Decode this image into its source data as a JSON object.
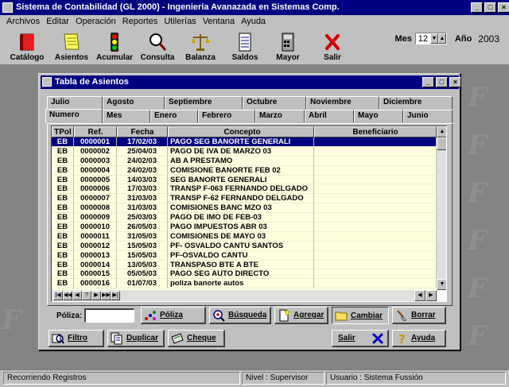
{
  "app": {
    "title": "Sistema de Contabilidad (GL 2000) - Ingeniería Avanazada en Sistemas Comp.",
    "controls": {
      "minimize": "_",
      "restore": "□",
      "close": "×"
    }
  },
  "menu": [
    "Archivos",
    "Editar",
    "Operación",
    "Reportes",
    "Utilerías",
    "Ventana",
    "Ayuda"
  ],
  "toolbar": {
    "buttons": [
      {
        "label": "Catálogo",
        "icon": "book-icon"
      },
      {
        "label": "Asientos",
        "icon": "notes-icon"
      },
      {
        "label": "Acumular",
        "icon": "traffic-light-icon"
      },
      {
        "label": "Consulta",
        "icon": "magnifier-icon"
      },
      {
        "label": "Balanza",
        "icon": "scale-icon"
      },
      {
        "label": "Saldos",
        "icon": "ledger-icon"
      },
      {
        "label": "Mayor",
        "icon": "calculator-icon"
      },
      {
        "label": "Salir",
        "icon": "red-x-icon"
      }
    ],
    "period": {
      "mes_label": "Mes",
      "mes_value": "12",
      "anio_label": "Año",
      "anio_value": "2003"
    }
  },
  "child": {
    "title": "Tabla de Asientos",
    "tabs_row1": [
      "Julio",
      "Agosto",
      "Septiembre",
      "Octubre",
      "Noviembre",
      "Diciembre"
    ],
    "tabs_row2": [
      "Numero",
      "Mes",
      "Enero",
      "Febrero",
      "Marzo",
      "Abril",
      "Mayo",
      "Junio"
    ],
    "active_tab": "Numero",
    "columns": [
      "TPol",
      "Ref.",
      "Fecha",
      "Concepto",
      "Beneficiario"
    ],
    "rows": [
      [
        "EB",
        "0000001",
        "17/02/03",
        "PAGO SEG BANORTE GENERALI",
        ""
      ],
      [
        "EB",
        "0000002",
        "25/04/03",
        "PAGO DE IVA DE MARZO 03",
        ""
      ],
      [
        "EB",
        "0000003",
        "24/02/03",
        "AB A PRESTAMO",
        ""
      ],
      [
        "EB",
        "0000004",
        "24/02/03",
        "COMISIONE BANORTE FEB 02",
        ""
      ],
      [
        "EB",
        "0000005",
        "14/03/03",
        "SEG BANORTE GENERALI",
        ""
      ],
      [
        "EB",
        "0000006",
        "17/03/03",
        "TRANSP F-063 FERNANDO DELGADO",
        ""
      ],
      [
        "EB",
        "0000007",
        "31/03/03",
        "TRANSP F-62 FERNANDO DELGADO",
        ""
      ],
      [
        "EB",
        "0000008",
        "31/03/03",
        "COMISIONES BANC MZO 03",
        ""
      ],
      [
        "EB",
        "0000009",
        "25/03/03",
        "PAGO DE IMO DE FEB-03",
        ""
      ],
      [
        "EB",
        "0000010",
        "26/05/03",
        "PAGO IMPUESTOS ABR 03",
        ""
      ],
      [
        "EB",
        "0000011",
        "31/05/03",
        "COMISIONES DE MAYO 03",
        ""
      ],
      [
        "EB",
        "0000012",
        "15/05/03",
        "PF-    OSVALDO CANTU SANTOS",
        ""
      ],
      [
        "EB",
        "0000013",
        "15/05/03",
        "PF-OSVALDO CANTU",
        ""
      ],
      [
        "EB",
        "0000014",
        "13/05/03",
        "TRANSPASO  BTE A BTE",
        ""
      ],
      [
        "EB",
        "0000015",
        "05/05/03",
        "PAGO SEG AUTO DIRECTO",
        ""
      ],
      [
        "EB",
        "0000016",
        "01/07/03",
        "poliza banorte autos",
        ""
      ]
    ],
    "selected_row": 0,
    "nav_buttons": [
      "|◀",
      "◀◀",
      "◀",
      "?",
      "▶",
      "▶▶",
      "▶|"
    ],
    "poliza_label": "Póliza:",
    "poliza_value": "",
    "buttons_row1": [
      {
        "label": "Póliza",
        "icon": "dots-icon"
      },
      {
        "label": "Búsqueda",
        "icon": "zoom-plus-icon"
      },
      {
        "label": "Agregar",
        "icon": "new-doc-icon"
      },
      {
        "label": "Cambiar",
        "icon": "folder-icon"
      },
      {
        "label": "Borrar",
        "icon": "broom-icon"
      }
    ],
    "buttons_row2": [
      {
        "label": "Filtro",
        "icon": "filter-magnifier-icon"
      },
      {
        "label": "Duplicar",
        "icon": "duplicate-icon"
      },
      {
        "label": "Cheque",
        "icon": "cheque-icon"
      },
      {
        "label": "Salir",
        "icon": "blue-x-icon"
      },
      {
        "label": "Ayuda",
        "icon": "question-icon"
      }
    ]
  },
  "status": {
    "left": "Recorriendo Registros",
    "nivel": "Nivel : Supervisor",
    "usuario": "Usuario : Sistema Fussión"
  },
  "colors": {
    "titlebar": "#000080",
    "selection": "#000080",
    "grid_bg": "#ffffe0",
    "desktop": "#848484"
  }
}
